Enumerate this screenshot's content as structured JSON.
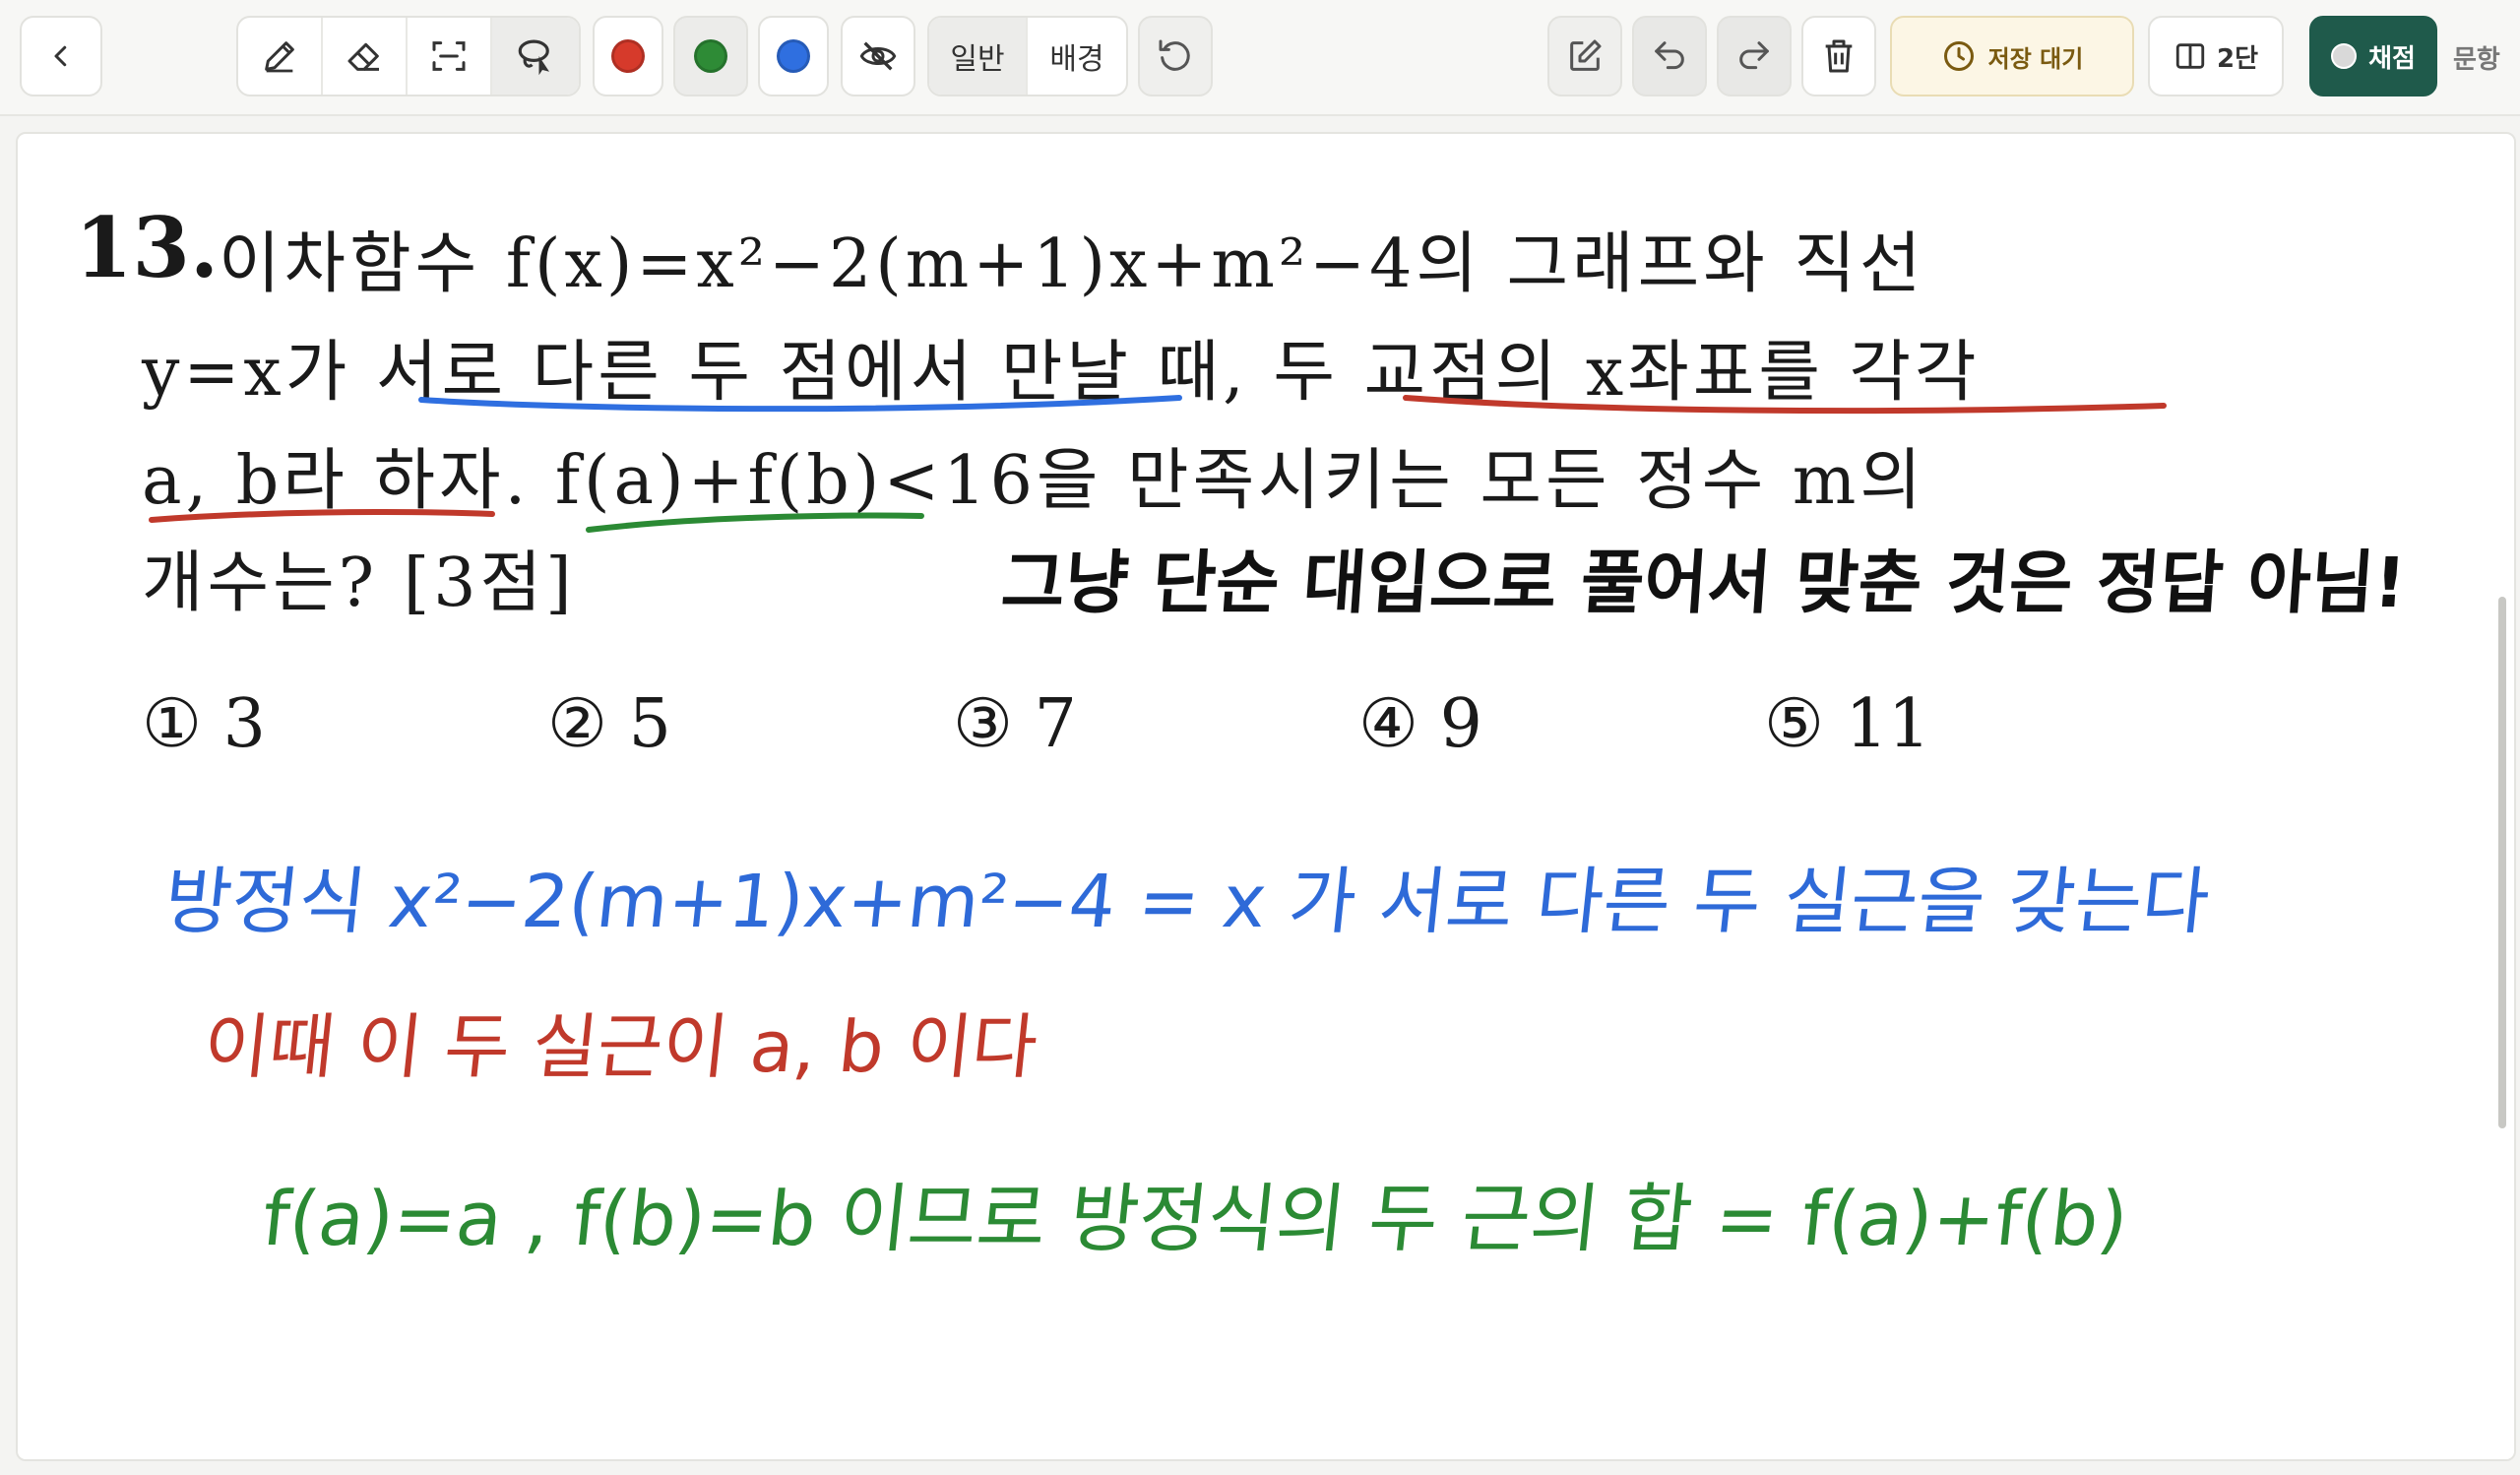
{
  "toolbar": {
    "back_icon": "chevron-left-icon",
    "tools": [
      {
        "name": "pen",
        "icon": "pen-icon"
      },
      {
        "name": "eraser",
        "icon": "eraser-icon"
      },
      {
        "name": "select-area",
        "icon": "select-area-icon"
      },
      {
        "name": "lasso",
        "icon": "lasso-icon"
      }
    ],
    "colors": [
      "#d63a2b",
      "#2e8b36",
      "#2f6fe0"
    ],
    "hide_icon": "eye-off-icon",
    "mode_general": "일반",
    "mode_background": "배경",
    "rotate_icon": "rotate-ccw-icon",
    "edit_icon": "edit-square-icon",
    "undo_icon": "undo-icon",
    "redo_icon": "redo-icon",
    "trash_icon": "trash-icon",
    "save_status": "저장 대기",
    "layout_label": "2단",
    "grade_label": "채점",
    "next_label": "문항"
  },
  "question": {
    "number": "13.",
    "line1": "이차함수 f(x)=x²−2(m+1)x+m²−4의 그래프와 직선",
    "line2": "y=x가 서로 다른 두 점에서 만날 때, 두 교점의 x좌표를 각각",
    "line3": "a, b라 하자. f(a)+f(b)<16을 만족시키는 모든 정수 m의",
    "line4": "개수는? [3점]",
    "choices": [
      "① 3",
      "② 5",
      "③ 7",
      "④ 9",
      "⑤ 11"
    ]
  },
  "annotations": {
    "black_note": "그냥 단순 대입으로 풀어서 맞춘 것은 정답 아님!",
    "blue_line": "방정식 x²−2(m+1)x+m²−4 = x 가 서로 다른 두 실근을 갖는다",
    "red_line": "이때 이 두 실근이 a, b 이다",
    "green_line": "f(a)=a , f(b)=b 이므로 방정식의 두 근의 합 = f(a)+f(b)"
  },
  "colors": {
    "annotation_blue": "#2e6ad8",
    "annotation_red": "#c0392b",
    "annotation_green": "#2b8a34",
    "grade_button": "#1f5a4b",
    "save_button_bg": "#fcf6e5"
  }
}
